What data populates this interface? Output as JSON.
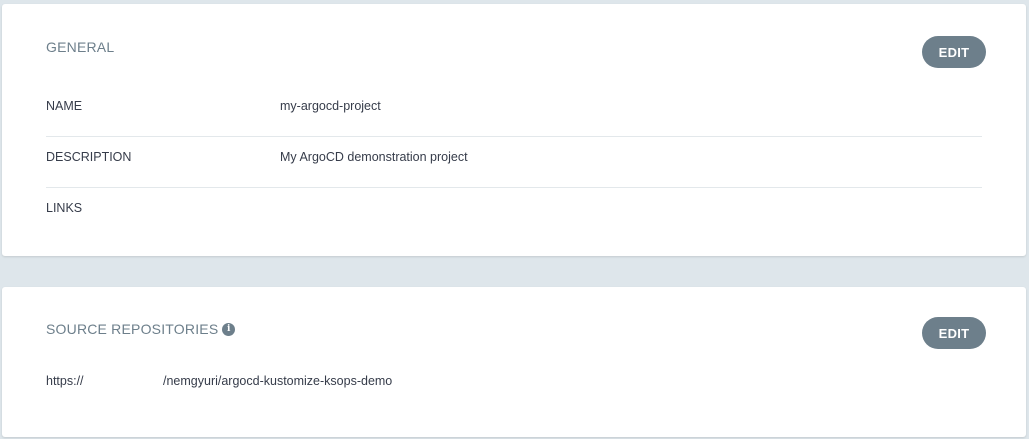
{
  "general": {
    "title": "GENERAL",
    "edit_label": "EDIT",
    "fields": [
      {
        "key": "NAME",
        "value": "my-argocd-project"
      },
      {
        "key": "DESCRIPTION",
        "value": "My ArgoCD demonstration project"
      },
      {
        "key": "LINKS",
        "value": ""
      }
    ]
  },
  "source_repositories": {
    "title": "SOURCE REPOSITORIES",
    "info_icon": "i",
    "edit_label": "EDIT",
    "repo": {
      "prefix": "https://",
      "path": "/nemgyuri/argocd-kustomize-ksops-demo"
    }
  },
  "colors": {
    "background": "#dee6eb",
    "card": "#ffffff",
    "button": "#6d7f8b",
    "text": "#363c4a",
    "muted": "#6d7f8b"
  }
}
